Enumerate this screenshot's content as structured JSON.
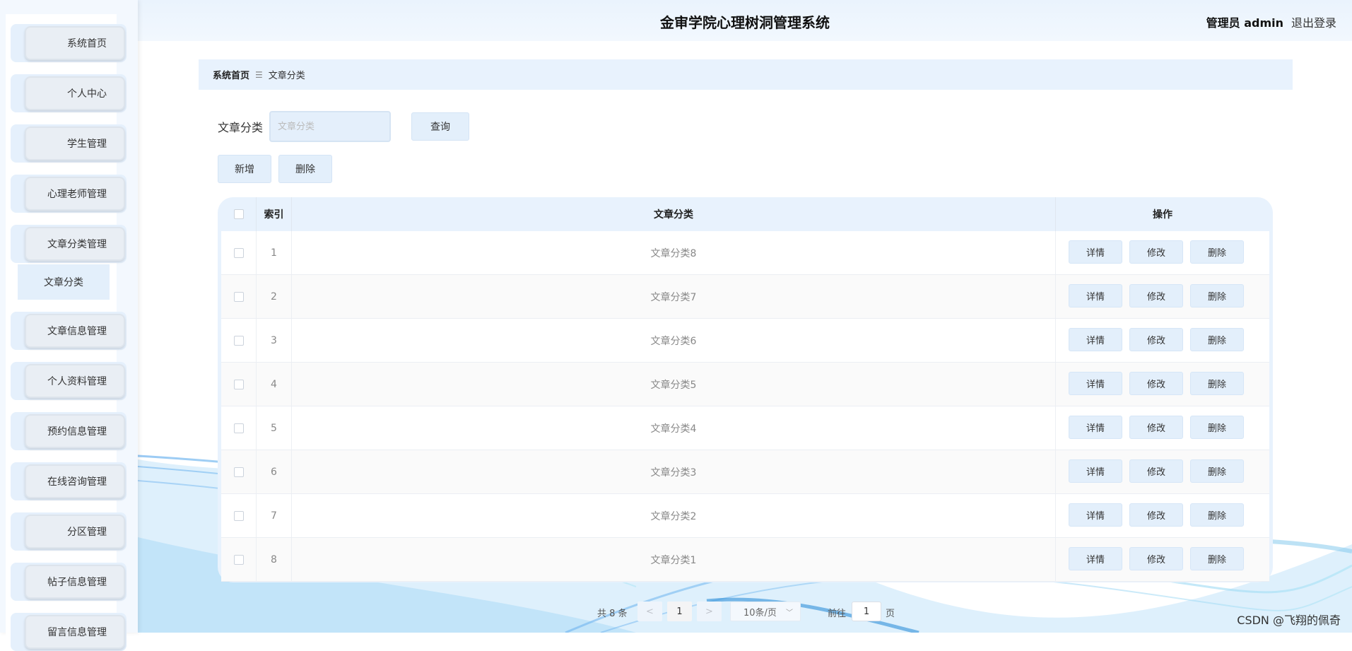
{
  "header": {
    "title": "金审学院心理树洞管理系统",
    "user": "管理员 admin",
    "logout": "退出登录"
  },
  "sidebar": {
    "items": [
      {
        "label": "系统首页"
      },
      {
        "label": "个人中心"
      },
      {
        "label": "学生管理"
      },
      {
        "label": "心理老师管理"
      },
      {
        "label": "文章分类管理"
      },
      {
        "label": "文章信息管理"
      },
      {
        "label": "个人资料管理"
      },
      {
        "label": "预约信息管理"
      },
      {
        "label": "在线咨询管理"
      },
      {
        "label": "分区管理"
      },
      {
        "label": "帖子信息管理"
      },
      {
        "label": "留言信息管理"
      }
    ],
    "subitem": "文章分类"
  },
  "breadcrumb": {
    "home": "系统首页",
    "separator": "☰",
    "current": "文章分类"
  },
  "search": {
    "label": "文章分类",
    "placeholder": "文章分类",
    "button": "查询"
  },
  "actions": {
    "add": "新增",
    "delete": "删除"
  },
  "table": {
    "headers": {
      "index": "索引",
      "category": "文章分类",
      "ops": "操作"
    },
    "rows": [
      {
        "index": "1",
        "category": "文章分类8"
      },
      {
        "index": "2",
        "category": "文章分类7"
      },
      {
        "index": "3",
        "category": "文章分类6"
      },
      {
        "index": "4",
        "category": "文章分类5"
      },
      {
        "index": "5",
        "category": "文章分类4"
      },
      {
        "index": "6",
        "category": "文章分类3"
      },
      {
        "index": "7",
        "category": "文章分类2"
      },
      {
        "index": "8",
        "category": "文章分类1"
      }
    ],
    "ops": {
      "detail": "详情",
      "edit": "修改",
      "delete": "删除"
    }
  },
  "pagination": {
    "total": "共 8 条",
    "prev": "<",
    "page": "1",
    "next": ">",
    "size": "10条/页",
    "goto": "前往",
    "goto_value": "1",
    "page_unit": "页"
  },
  "watermark": "CSDN @飞翔的佩奇"
}
